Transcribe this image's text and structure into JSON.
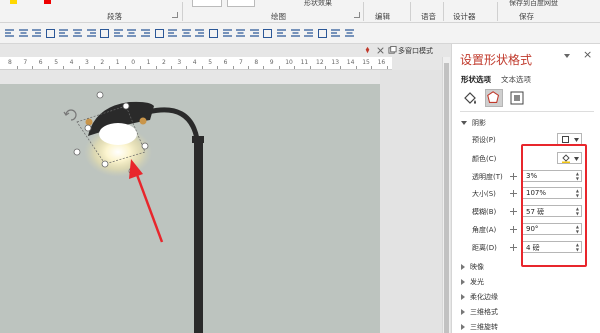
{
  "ribbon": {
    "groups": [
      "段落",
      "绘图",
      "编辑",
      "语音",
      "设计器",
      "保存"
    ],
    "shape_effects_partial": "形状效果",
    "save_partial": "保存到百度网盘"
  },
  "toolbar": {
    "icons": [
      "align-left-icon",
      "align-center-icon",
      "align-right-icon",
      "justify-icon",
      "distribute-icon",
      "table-icon",
      "text-box-icon",
      "crop-icon",
      "image-icon",
      "save-image-icon",
      "group-icon",
      "rotate-icon",
      "arrange-icon",
      "flip-icon",
      "shape-icon",
      "oval-icon",
      "outline-icon",
      "fill-icon",
      "shadow-icon",
      "effects-icon",
      "bring-front-icon",
      "send-back-icon",
      "pick-icon",
      "undo-icon",
      "redo-icon",
      "more-icon"
    ]
  },
  "window": {
    "multi_window_label": "多窗口模式"
  },
  "ruler": {
    "numbers": [
      "8",
      "7",
      "6",
      "5",
      "4",
      "3",
      "2",
      "1",
      "0",
      "1",
      "2",
      "3",
      "4",
      "5",
      "6",
      "7",
      "8",
      "9",
      "10",
      "11",
      "12",
      "13",
      "14",
      "15",
      "16"
    ]
  },
  "pane": {
    "title": "设置形状格式",
    "tab_shape": "形状选项",
    "tab_text": "文本选项",
    "section_shadow": "阴影",
    "preset_label": "预设(P)",
    "color_label": "颜色(C)",
    "properties": [
      {
        "label": "透明度(T)",
        "value": "3%"
      },
      {
        "label": "大小(S)",
        "value": "107%"
      },
      {
        "label": "模糊(B)",
        "value": "57 磅"
      },
      {
        "label": "角度(A)",
        "value": "90°"
      },
      {
        "label": "距离(D)",
        "value": "4 磅"
      }
    ],
    "collapsed_sections": [
      "映像",
      "发光",
      "柔化边缘",
      "三维格式",
      "三维旋转"
    ]
  },
  "colors": {
    "accent_red": "#e8262c",
    "slide_bg": "#bdc4bf",
    "lamp_dark": "#2a2a2a",
    "glow": "#fff3c0"
  }
}
